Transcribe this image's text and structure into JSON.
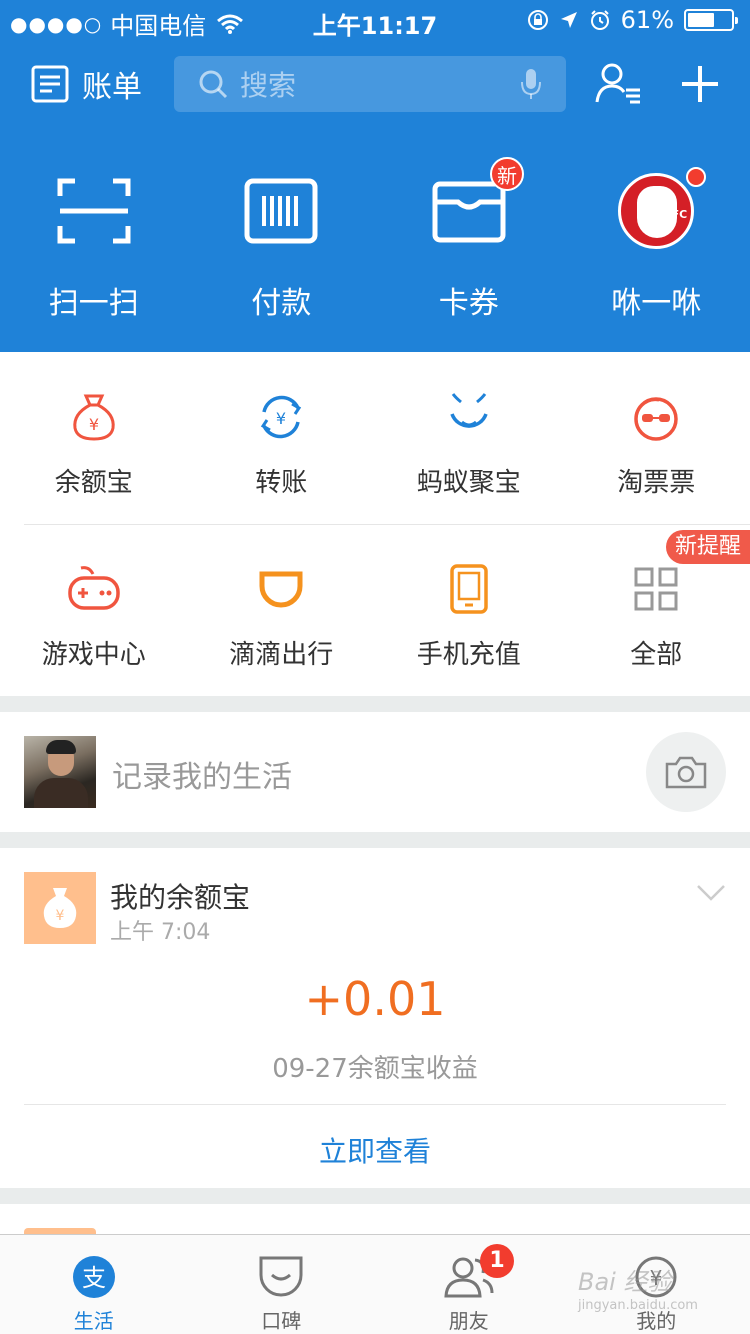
{
  "status_bar": {
    "signal": "●●●●○",
    "carrier": "中国电信",
    "time": "上午11:17",
    "battery": "61%",
    "battery_level": 0.61
  },
  "navbar": {
    "bill_label": "账单",
    "search_placeholder": "搜索"
  },
  "quick_actions": [
    {
      "label": "扫一扫",
      "icon": "scan-icon"
    },
    {
      "label": "付款",
      "icon": "barcode-pay-icon"
    },
    {
      "label": "卡券",
      "icon": "card-wallet-icon",
      "badge": "新"
    },
    {
      "label": "咻一咻",
      "icon": "kfc-logo-icon"
    }
  ],
  "services": [
    {
      "label": "余额宝",
      "icon": "money-bag-icon",
      "color": "#f0553f"
    },
    {
      "label": "转账",
      "icon": "transfer-icon",
      "color": "#1f82d8"
    },
    {
      "label": "蚂蚁聚宝",
      "icon": "ant-fortune-icon",
      "color": "#1f82d8"
    },
    {
      "label": "淘票票",
      "icon": "taopiaopiao-icon",
      "color": "#f0553f"
    },
    {
      "label": "游戏中心",
      "icon": "gamepad-icon",
      "color": "#f0553f"
    },
    {
      "label": "滴滴出行",
      "icon": "didi-icon",
      "color": "#f5921e"
    },
    {
      "label": "手机充值",
      "icon": "phone-topup-icon",
      "color": "#f5921e"
    },
    {
      "label": "全部",
      "icon": "grid-all-icon",
      "color": "#999999"
    }
  ],
  "remind_tag": "新提醒",
  "record": {
    "text": "记录我的生活"
  },
  "card": {
    "title": "我的余额宝",
    "time": "上午 7:04",
    "amount": "+0.01",
    "subtitle": "09-27余额宝收益",
    "link": "立即查看"
  },
  "tabbar": {
    "items": [
      {
        "label": "生活",
        "active": true
      },
      {
        "label": "口碑"
      },
      {
        "label": "朋友",
        "badge": "1"
      },
      {
        "label": "我的"
      }
    ]
  },
  "watermark": {
    "text": "Bai 经验",
    "sub": "jingyan.baidu.com"
  },
  "colors": {
    "brand_blue": "#1f82d8",
    "badge_red": "#f23c2e",
    "amount_orange": "#f06e21"
  }
}
